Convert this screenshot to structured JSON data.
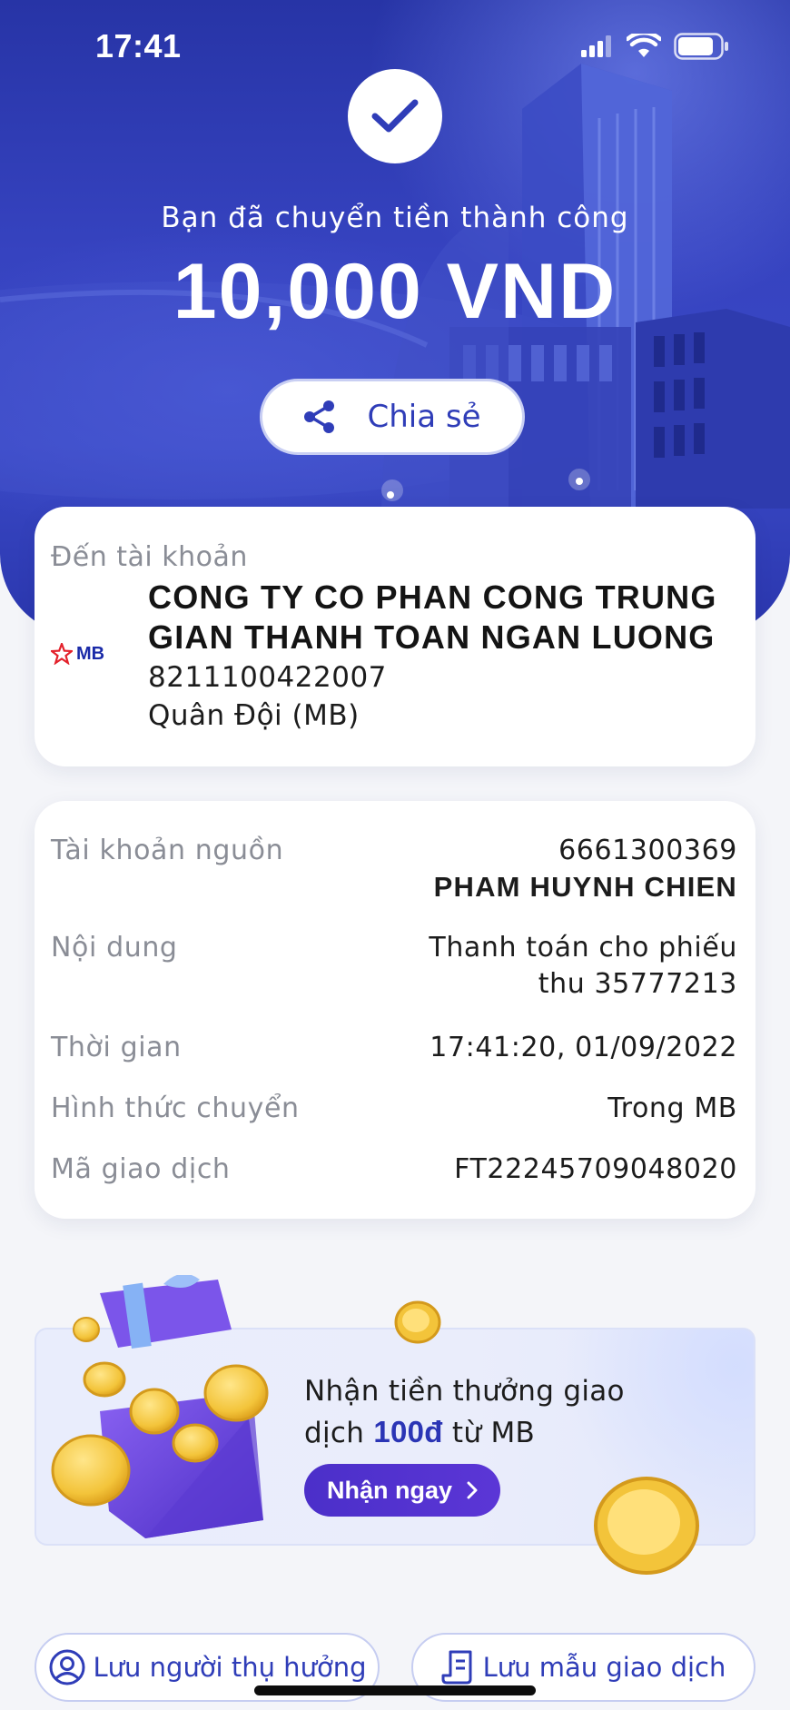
{
  "status_bar": {
    "time": "17:41"
  },
  "hero": {
    "success_text": "Bạn đã chuyển tiền thành công",
    "amount": "10,000 VND",
    "share_label": "Chia sẻ"
  },
  "destination": {
    "label": "Đến tài khoản",
    "bank_logo_text": "MB",
    "name": "CONG TY CO PHAN CONG TRUNG GIAN THANH TOAN NGAN LUONG",
    "account_number": "8211100422007",
    "bank_name": "Quân Đội (MB)"
  },
  "details": {
    "source_label": "Tài khoản nguồn",
    "source_account": "6661300369",
    "source_name": "PHAM HUYNH CHIEN",
    "content_label": "Nội dung",
    "content_line1": "Thanh toán cho phiếu",
    "content_line2": "thu 35777213",
    "time_label": "Thời gian",
    "time_value": "17:41:20, 01/09/2022",
    "method_label": "Hình thức chuyển",
    "method_value": "Trong MB",
    "txn_label": "Mã giao dịch",
    "txn_value": "FT22245709048020"
  },
  "promo": {
    "line1": "Nhận tiền thưởng giao",
    "line2_prefix": "dịch ",
    "line2_highlight": "100đ",
    "line2_suffix": " từ MB",
    "button_label": "Nhận ngay"
  },
  "bottom_actions": {
    "save_beneficiary": "Lưu người thụ hưởng",
    "save_template": "Lưu mẫu giao dịch"
  },
  "colors": {
    "brand_blue": "#2f3db8",
    "hero_dark": "#2734a6",
    "promo_purple": "#4b2fc9",
    "coin_gold": "#f3c43a"
  },
  "icons": [
    "signal-icon",
    "wifi-icon",
    "battery-icon",
    "checkmark-icon",
    "share-icon",
    "mb-logo-icon",
    "chevron-right-icon",
    "user-circle-icon",
    "receipt-icon",
    "gift-box-illustration",
    "coin-illustration"
  ]
}
